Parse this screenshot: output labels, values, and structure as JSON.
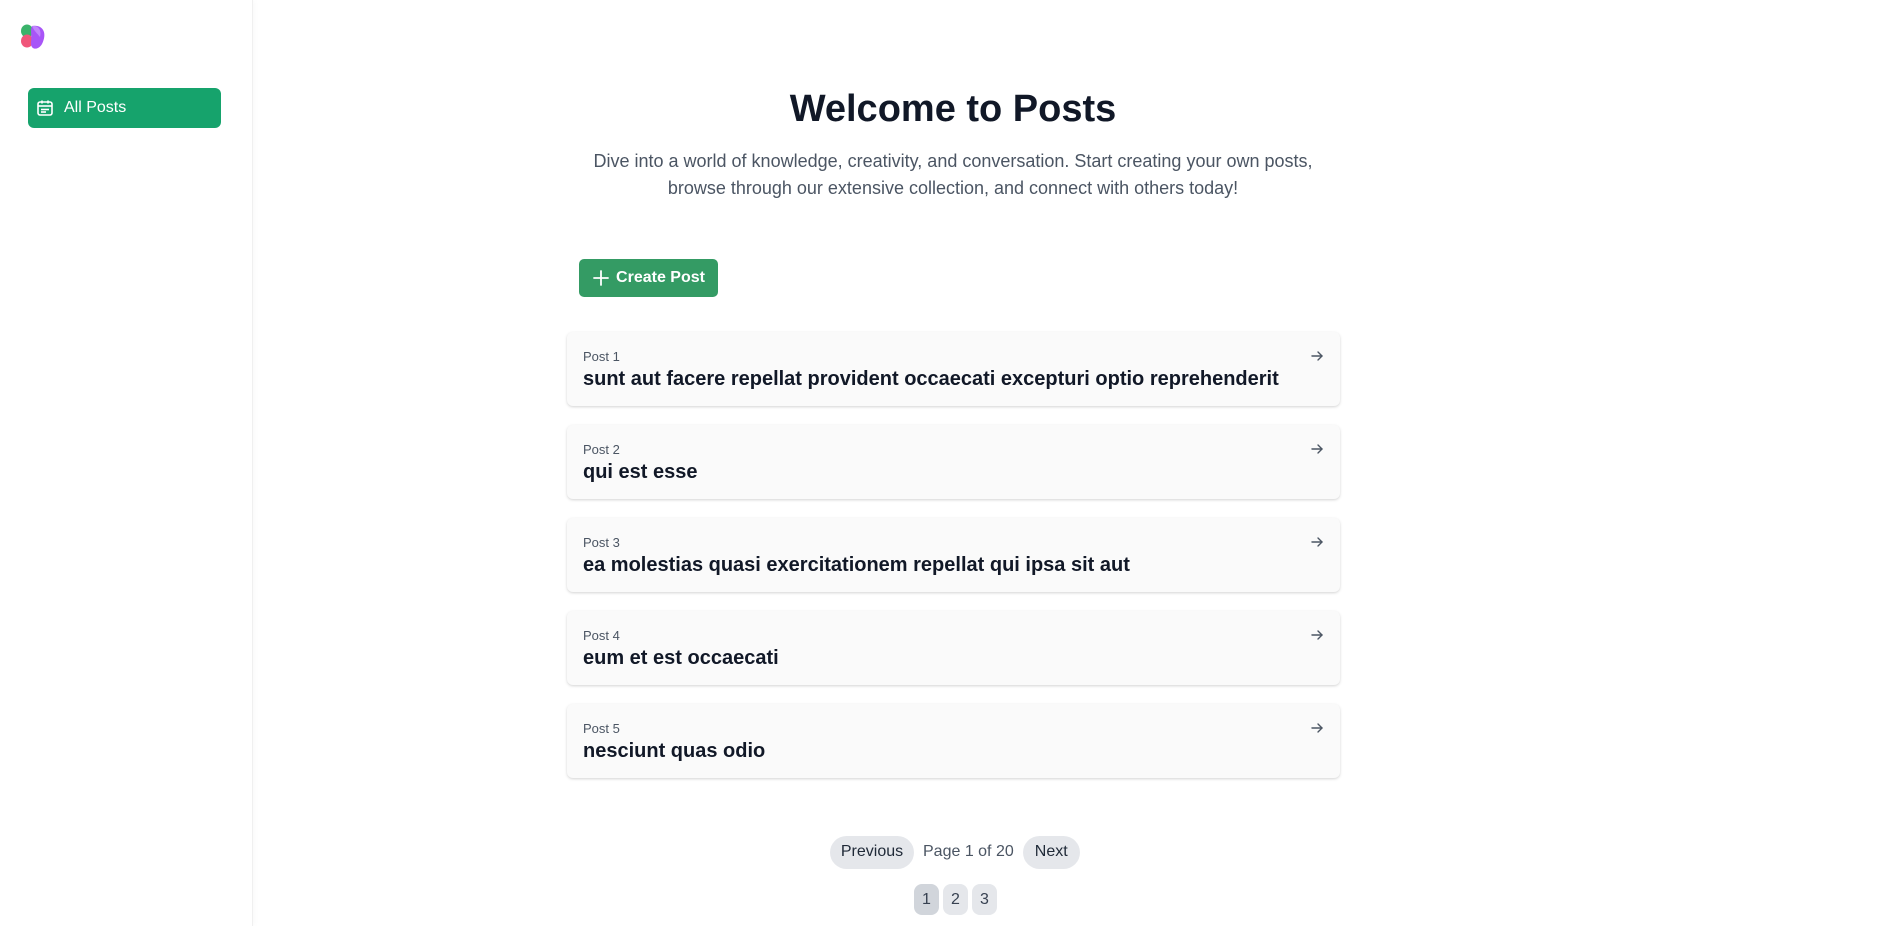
{
  "sidebar": {
    "items": [
      {
        "label": "All Posts",
        "icon": "calendar-icon",
        "active": true
      }
    ],
    "accent": "#16a36c"
  },
  "hero": {
    "title": "Welcome to Posts",
    "subtitle_line1": "Dive into a world of knowledge, creativity, and conversation. Start creating your own posts,",
    "subtitle_line2": "browse through our extensive collection, and connect with others today!"
  },
  "actions": {
    "create_label": "Create Post",
    "create_color": "#349b64"
  },
  "posts": [
    {
      "number": "Post 1",
      "title": "sunt aut facere repellat provident occaecati excepturi optio reprehenderit"
    },
    {
      "number": "Post 2",
      "title": "qui est esse"
    },
    {
      "number": "Post 3",
      "title": "ea molestias quasi exercitationem repellat qui ipsa sit aut"
    },
    {
      "number": "Post 4",
      "title": "eum et est occaecati"
    },
    {
      "number": "Post 5",
      "title": "nesciunt quas odio"
    }
  ],
  "pagination": {
    "previous_label": "Previous",
    "page_info": "Page 1 of 20",
    "next_label": "Next",
    "pages": [
      "1",
      "2",
      "3"
    ],
    "current_page": "1"
  }
}
